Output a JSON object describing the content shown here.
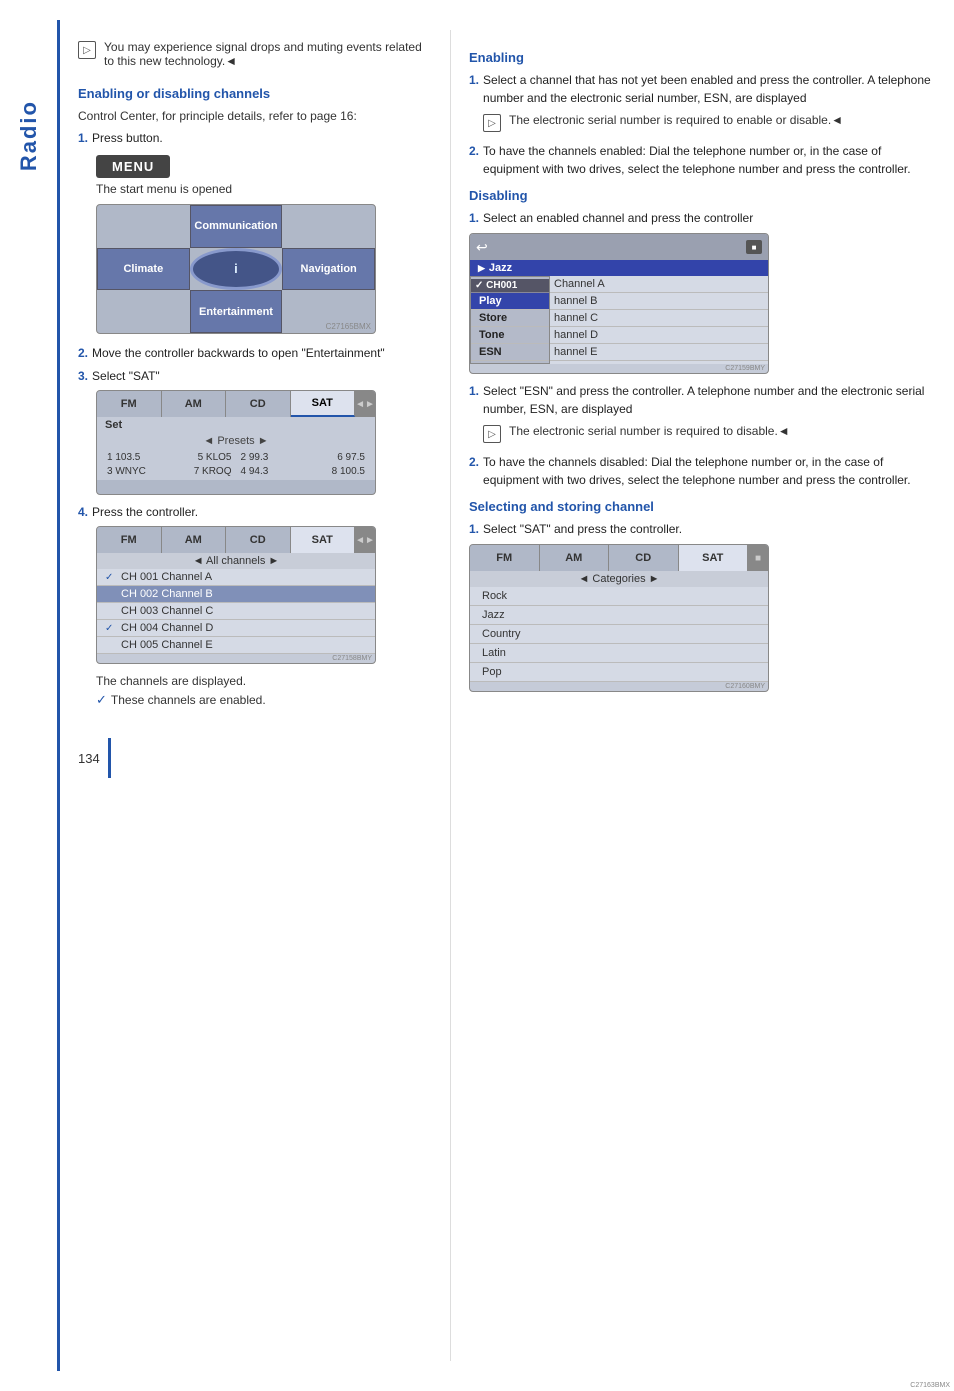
{
  "sidebar": {
    "label": "Radio",
    "accent_color": "#2255aa"
  },
  "intro_note": {
    "text": "You may experience signal drops and muting events related to this new technology.◄"
  },
  "left_section": {
    "title": "Enabling or disabling channels",
    "intro_text": "Control Center, for principle details, refer to page 16:",
    "step1": {
      "number": "1.",
      "text": "Press button."
    },
    "menu_button_label": "MENU",
    "start_menu_text": "The start menu is opened",
    "nav_menu": {
      "top_label": "Communication",
      "left_label": "Climate",
      "center_label": "i",
      "right_label": "Navigation",
      "bottom_label": "Entertainment"
    },
    "step2": {
      "number": "2.",
      "text": "Move the controller backwards to open \"Entertainment\""
    },
    "step3": {
      "number": "3.",
      "text": "Select \"SAT\""
    },
    "tuner": {
      "tabs": [
        "FM",
        "AM",
        "CD",
        "SAT"
      ],
      "active_tab": "SAT",
      "set_label": "Set",
      "presets_label": "◄ Presets ►",
      "frequencies": [
        {
          "left": "1 103.5",
          "right": "5 KLO5"
        },
        {
          "left": "2 99.3",
          "right": "6 97.5"
        },
        {
          "left": "3 WNYC",
          "right": "7 KROQ"
        },
        {
          "left": "4 94.3",
          "right": "8 100.5"
        }
      ]
    },
    "step4": {
      "number": "4.",
      "text": "Press the controller."
    },
    "channel_list": {
      "tabs": [
        "FM",
        "AM",
        "CD",
        "SAT"
      ],
      "active_tab": "SAT",
      "all_channels_label": "◄ All channels ►",
      "channels": [
        {
          "id": "CH 001 Channel A",
          "checked": true,
          "selected": false
        },
        {
          "id": "CH 002 Channel B",
          "checked": false,
          "selected": true
        },
        {
          "id": "CH 003 Channel C",
          "checked": false,
          "selected": false
        },
        {
          "id": "CH 004 Channel D",
          "checked": true,
          "selected": false
        },
        {
          "id": "CH 005 Channel E",
          "checked": false,
          "selected": false
        }
      ]
    },
    "channels_displayed_note": "The channels are displayed.",
    "channels_enabled_note": "These channels are enabled.",
    "page_number": "134"
  },
  "right_section": {
    "enabling_title": "Enabling",
    "enabling_steps": [
      {
        "number": "1.",
        "text": "Select a channel that has not yet been enabled and press the controller. A telephone number and the electronic serial number, ESN, are displayed"
      }
    ],
    "enabling_note": "The electronic serial number is required to enable or disable.◄",
    "enabling_step2": {
      "number": "2.",
      "text": "To have the channels enabled: Dial the telephone number or, in the case of equipment with two drives, select the telephone number and press the controller."
    },
    "disabling_title": "Disabling",
    "disabling_step1": {
      "number": "1.",
      "text": "Select an enabled channel and press the controller"
    },
    "disable_menu": {
      "jazz_label": "Jazz",
      "overlay_items": [
        "Play",
        "Store",
        "Tone",
        "ESN"
      ],
      "selected_overlay": "Play",
      "channels": [
        "hannel A",
        "hannel B",
        "hannel C",
        "hannel D",
        "hannel E"
      ],
      "active_channel": "CH 001 Channel A"
    },
    "disabling_step2": {
      "number": "1.",
      "text": "Select \"ESN\" and press the controller. A telephone number and the electronic serial number, ESN, are displayed"
    },
    "disabling_note": "The electronic serial number is required to disable.◄",
    "disabling_step3": {
      "number": "2.",
      "text": "To have the channels disabled: Dial the telephone number or, in the case of equipment with two drives, select the telephone number and press the controller."
    },
    "selecting_title": "Selecting and storing channel",
    "selecting_step1": {
      "number": "1.",
      "text": "Select \"SAT\" and press the controller."
    },
    "sat_categories": {
      "tabs": [
        "FM",
        "AM",
        "CD",
        "SAT"
      ],
      "active_tab": "SAT",
      "categories_label": "◄ Categories ►",
      "items": [
        "Rock",
        "Jazz",
        "Country",
        "Latin",
        "Pop"
      ]
    }
  }
}
